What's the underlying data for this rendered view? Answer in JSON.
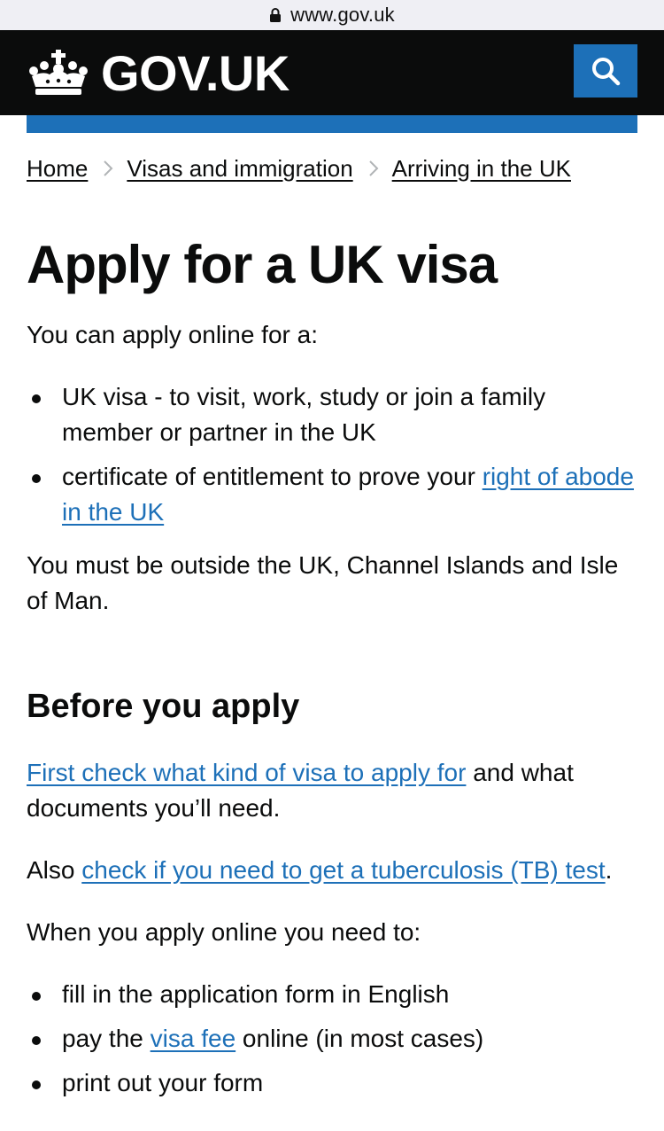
{
  "browser": {
    "url": "www.gov.uk"
  },
  "header": {
    "logo_text": "GOV.UK"
  },
  "breadcrumb": [
    {
      "label": "Home"
    },
    {
      "label": "Visas and immigration"
    },
    {
      "label": "Arriving in the UK"
    }
  ],
  "main": {
    "title": "Apply for a UK visa",
    "intro": "You can apply online for a:",
    "bullets1": {
      "item1": "UK visa - to visit, work, study or join a family member or partner in the UK",
      "item2_text": "certificate of entitlement to prove your ",
      "item2_link": "right of abode in the UK"
    },
    "outside": "You must be outside the UK, Channel Islands and Isle of Man.",
    "before_heading": "Before you apply",
    "first_check_link": "First check what kind of visa to apply for",
    "first_check_rest": " and what documents you’ll need.",
    "also_text": "Also ",
    "tb_link": "check if you need to get a tuberculosis (TB) test",
    "also_end": ".",
    "when_text": "When you apply online you need to:",
    "bullets2": {
      "item1": "fill in the application form in English",
      "item2_pre": "pay the ",
      "item2_link": "visa fee",
      "item2_post": " online (in most cases)",
      "item3": "print out your form"
    }
  },
  "colors": {
    "header_bg": "#0b0c0c",
    "brand_blue": "#1d70b8",
    "link": "#1d70b8"
  }
}
